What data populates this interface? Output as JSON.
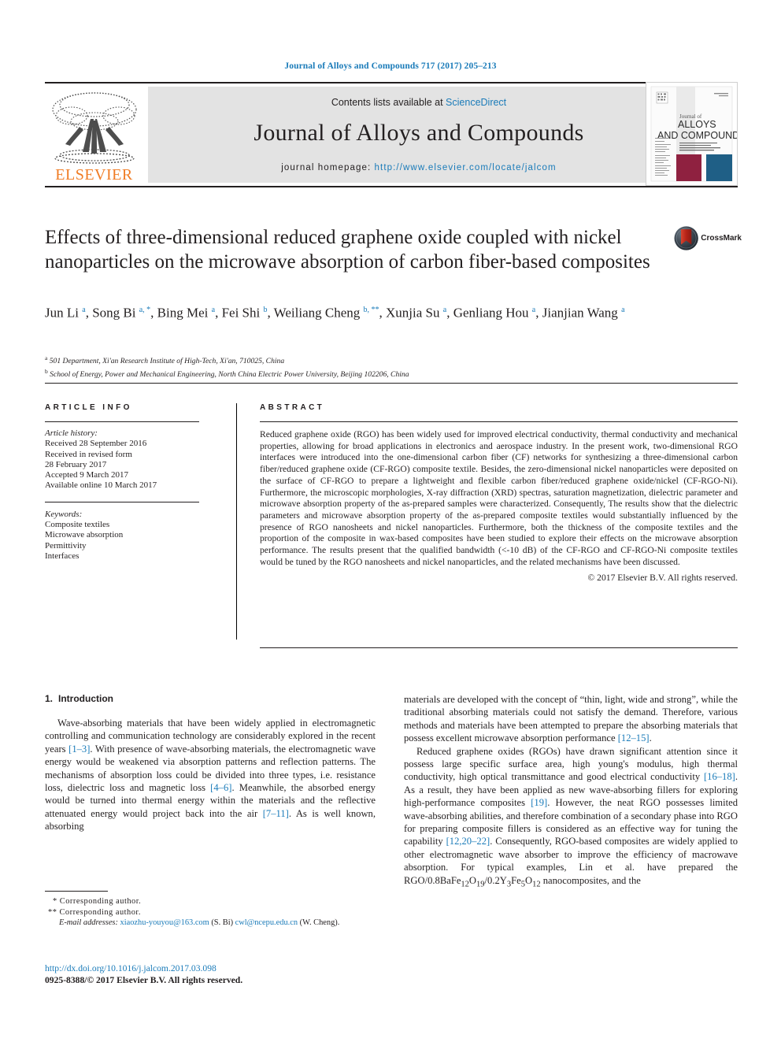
{
  "running_head": "Journal of Alloys and Compounds 717 (2017) 205–213",
  "masthead": {
    "contents_prefix": "Contents lists available at ",
    "sciencedirect": "ScienceDirect",
    "journal_name": "Journal of Alloys and Compounds",
    "homepage_prefix": "journal homepage: ",
    "homepage_url": "http://www.elsevier.com/locate/jalcom",
    "publisher": "ELSEVIER",
    "cover": {
      "line1": "Journal of",
      "line2": "ALLOYS",
      "line3": "AND COMPOUNDS"
    }
  },
  "article": {
    "title": "Effects of three-dimensional reduced graphene oxide coupled with nickel nanoparticles on the microwave absorption of carbon fiber-based composites",
    "crossmark_label": "CrossMark",
    "authors_html": "Jun Li <sup>a</sup>, Song Bi <sup>a, *</sup>, Bing Mei <sup>a</sup>, Fei Shi <sup>b</sup>, Weiliang Cheng <sup>b, **</sup>, Xunjia Su <sup>a</sup>, Genliang Hou <sup>a</sup>, Jianjian Wang <sup>a</sup>",
    "affiliations": [
      {
        "mark": "a",
        "text": "501 Department, Xi'an Research Institute of High-Tech, Xi'an, 710025, China"
      },
      {
        "mark": "b",
        "text": "School of Energy, Power and Mechanical Engineering, North China Electric Power University, Beijing 102206, China"
      }
    ]
  },
  "article_info": {
    "heading": "ARTICLE INFO",
    "history_label": "Article history:",
    "history_lines": [
      "Received 28 September 2016",
      "Received in revised form",
      "28 February 2017",
      "Accepted 9 March 2017",
      "Available online 10 March 2017"
    ],
    "keywords_label": "Keywords:",
    "keywords": [
      "Composite textiles",
      "Microwave absorption",
      "Permittivity",
      "Interfaces"
    ]
  },
  "abstract": {
    "heading": "ABSTRACT",
    "text": "Reduced graphene oxide (RGO) has been widely used for improved electrical conductivity, thermal conductivity and mechanical properties, allowing for broad applications in electronics and aerospace industry. In the present work, two-dimensional RGO interfaces were introduced into the one-dimensional carbon fiber (CF) networks for synthesizing a three-dimensional carbon fiber/reduced graphene oxide (CF-RGO) composite textile. Besides, the zero-dimensional nickel nanoparticles were deposited on the surface of CF-RGO to prepare a lightweight and flexible carbon fiber/reduced graphene oxide/nickel (CF-RGO-Ni). Furthermore, the microscopic morphologies, X-ray diffraction (XRD) spectras, saturation magnetization, dielectric parameter and microwave absorption property of the as-prepared samples were characterized. Consequently, The results show that the dielectric parameters and microwave absorption property of the as-prepared composite textiles would substantially influenced by the presence of RGO nanosheets and nickel nanoparticles. Furthermore, both the thickness of the composite textiles and the proportion of the composite in wax-based composites have been studied to explore their effects on the microwave absorption performance. The results present that the qualified bandwidth (<-10 dB) of the CF-RGO and CF-RGO-Ni composite textiles would be tuned by the RGO nanosheets and nickel nanoparticles, and the related mechanisms have been discussed.",
    "copyright": "© 2017 Elsevier B.V. All rights reserved."
  },
  "body": {
    "section_number": "1.",
    "section_title": "Introduction",
    "left_paragraph_html": "Wave-absorbing materials that have been widely applied in electromagnetic controlling and communication technology are considerably explored in the recent years <span class=\"ref\">[1–3]</span>. With presence of wave-absorbing materials, the electromagnetic wave energy would be weakened via absorption patterns and reflection patterns. The mechanisms of absorption loss could be divided into three types, i.e. resistance loss, dielectric loss and magnetic loss <span class=\"ref\">[4–6]</span>. Meanwhile, the absorbed energy would be turned into thermal energy within the materials and the reflective attenuated energy would project back into the air <span class=\"ref\">[7–11]</span>. As is well known, absorbing",
    "right_paragraph1_html": "materials are developed with the concept of “thin, light, wide and strong”, while the traditional absorbing materials could not satisfy the demand. Therefore, various methods and materials have been attempted to prepare the absorbing materials that possess excellent microwave absorption performance <span class=\"ref\">[12–15]</span>.",
    "right_paragraph2_html": "Reduced graphene oxides (RGOs) have drawn significant attention since it possess large specific surface area, high young's modulus, high thermal conductivity, high optical transmittance and good electrical conductivity <span class=\"ref\">[16–18]</span>. As a result, they have been applied as new wave-absorbing fillers for exploring high-performance composites <span class=\"ref\">[19]</span>. However, the neat RGO possesses limited wave-absorbing abilities, and therefore combination of a secondary phase into RGO for preparing composite fillers is considered as an effective way for tuning the capability <span class=\"ref\">[12,20–22]</span>. Consequently, RGO-based composites are widely applied to other electromagnetic wave absorber to improve the efficiency of macrowave absorption. For typical examples, Lin et al. have prepared the RGO/0.8BaFe<sub>12</sub>O<sub>19</sub>/0.2Y<sub>3</sub>Fe<sub>5</sub>O<sub>12</sub> nanocomposites, and the"
  },
  "footnotes": {
    "corresponding1": "* Corresponding author.",
    "corresponding2": "** Corresponding author.",
    "email_label": "E-mail addresses:",
    "email1": "xiaozhu-youyou@163.com",
    "email1_owner": "(S. Bi)",
    "email2": "cwl@ncepu.edu.cn",
    "email2_owner": "(W. Cheng).",
    "doi": "http://dx.doi.org/10.1016/j.jalcom.2017.03.098",
    "issn_line": "0925-8388/© 2017 Elsevier B.V. All rights reserved."
  },
  "colors": {
    "link_blue": "#1a7bb9",
    "elsevier_orange": "#f07c24",
    "band_gray": "#e3e3e3",
    "cover_red": "#8f2140",
    "cover_blue": "#1f5f86",
    "crossmark_red": "#b42318"
  }
}
